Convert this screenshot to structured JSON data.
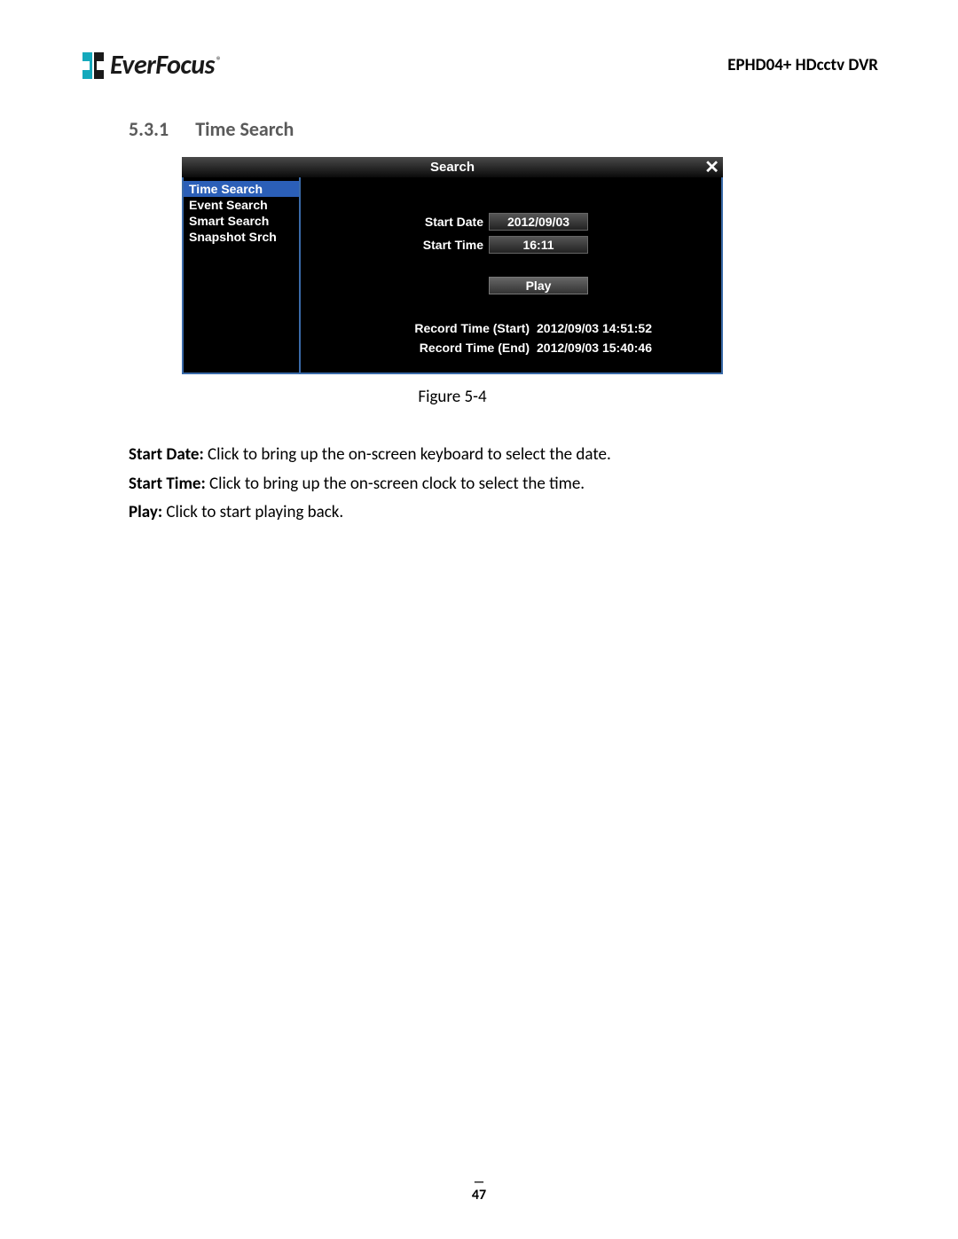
{
  "header": {
    "logo_text": "EverFocus",
    "logo_reg": "®",
    "product": "EPHD04+  HDcctv DVR"
  },
  "section": {
    "number": "5.3.1",
    "title": "Time Search"
  },
  "dvr": {
    "window_title": "Search",
    "sidebar": [
      "Time Search",
      "Event Search",
      "Smart Search",
      "Snapshot Srch"
    ],
    "fields": {
      "start_date_label": "Start Date",
      "start_date_value": "2012/09/03",
      "start_time_label": "Start Time",
      "start_time_value": "16:11"
    },
    "play_label": "Play",
    "record_start_label": "Record Time (Start)",
    "record_start_value": "2012/09/03 14:51:52",
    "record_end_label": "Record Time (End)",
    "record_end_value": "2012/09/03 15:40:46"
  },
  "figure_caption": "Figure 5-4",
  "descriptions": {
    "start_date_b": "Start Date:",
    "start_date_t": " Click to bring up the on-screen keyboard to select the date.",
    "start_time_b": "Start Time:",
    "start_time_t": " Click to bring up the on-screen clock to select the time.",
    "play_b": "Play:",
    "play_t": " Click to start playing back."
  },
  "footer": {
    "dash": "—",
    "page": "47"
  }
}
